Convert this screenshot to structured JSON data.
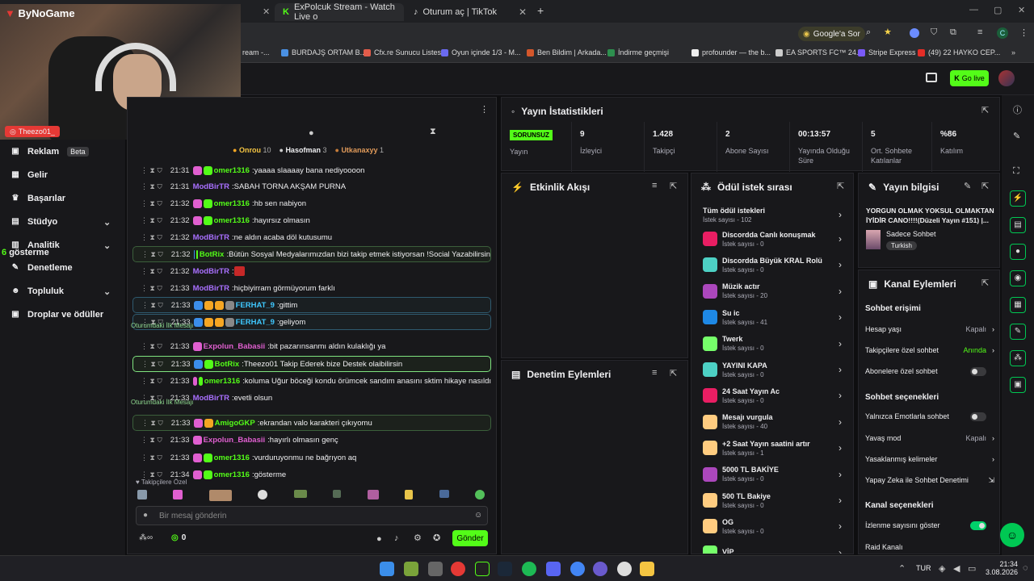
{
  "browser": {
    "tabs": [
      {
        "label": "ExPolcuk Stream - Watch Live o",
        "close": "✕"
      },
      {
        "label": "Oturum aç | TikTok",
        "close": "✕"
      }
    ],
    "add_tab": "+",
    "google_btn": "Google'a Sor",
    "bookmarks": [
      "ream -...",
      "BURDAJŞ ORTAM B...",
      "Cfx.re Sunucu Listesi",
      "Oyun içinde 1/3 - M...",
      "Ben Bildim | Arkada...",
      "İndirme geçmişi",
      "profounder — the b...",
      "EA SPORTS FC™ 24...",
      "Stripe Express",
      "(49) 22 HAYKO CEP..."
    ]
  },
  "webcam": {
    "logo": "ByNoGame",
    "username": "Theezo01_"
  },
  "topbar": {
    "go_live": "Go live"
  },
  "sidebar": {
    "items": [
      {
        "label": "Reklam",
        "badge": "Beta"
      },
      {
        "label": "Gelir"
      },
      {
        "label": "Başarılar"
      },
      {
        "label": "Stüdyo"
      },
      {
        "label": "Analitik"
      },
      {
        "label": "Denetleme"
      },
      {
        "label": "Topluluk"
      },
      {
        "label": "Droplar ve ödüller"
      }
    ],
    "overlay_num": "6",
    "overlay_text": "gösterme"
  },
  "chat": {
    "leaders": [
      {
        "name": "Onrou",
        "count": "10"
      },
      {
        "name": "Hasofman",
        "count": "3"
      },
      {
        "name": "Utkanaxyy",
        "count": "1"
      }
    ],
    "messages": [
      {
        "time": "21:31",
        "user": "omer1316",
        "text": "yaaaa slaaaay bana nediyoooon"
      },
      {
        "time": "21:31",
        "user": "ModBirTR",
        "text": "SABAH TORNA AKŞAM PURNA"
      },
      {
        "time": "21:32",
        "user": "omer1316",
        "text": "hb sen nabiyon"
      },
      {
        "time": "21:32",
        "user": "omer1316",
        "text": "hayırsız olmasın"
      },
      {
        "time": "21:32",
        "user": "ModBirTR",
        "text": "ne aldın acaba döl kutusumu"
      },
      {
        "time": "21:32",
        "user": "BotRix",
        "text": "Bütün Sosyal Medyalarımızdan bizi takip etmek istiyorsan !Social Yazabilirsin"
      },
      {
        "time": "21:32",
        "user": "ModBirTR",
        "text": ""
      },
      {
        "time": "21:33",
        "user": "ModBirTR",
        "text": "hiçbiyirram görmüyorum farklı"
      },
      {
        "time": "21:33",
        "user": "FERHAT_9",
        "text": "gittim"
      },
      {
        "time": "21:33",
        "user": "FERHAT_9",
        "text": "geliyom"
      },
      {
        "time": "21:33",
        "user": "Expolun_Babasii",
        "text": "bit pazarınsanmı aldın kulaklığı ya"
      },
      {
        "time": "21:33",
        "user": "BotRix",
        "text": "Theezo01 Takip Ederek bize Destek olaibilirsin"
      },
      {
        "time": "21:33",
        "user": "omer1316",
        "text": "koluma Uğur böceği kondu örümcek sandım anasını sktim hikaye nasıldı"
      },
      {
        "time": "21:33",
        "user": "ModBirTR",
        "text": "evetli olsun"
      },
      {
        "time": "21:33",
        "user": "AmigoGKP",
        "text": "ekrandan valo karakteri çıkıyomu"
      },
      {
        "time": "21:33",
        "user": "Expolun_Babasii",
        "text": "hayırlı olmasın genç"
      },
      {
        "time": "21:33",
        "user": "omer1316",
        "text": "vurduruyonmu ne bağrıyon aq"
      },
      {
        "time": "21:34",
        "user": "omer1316",
        "text": "gösterme"
      }
    ],
    "first_msg_label": "Oturumdaki İlk Mesajı",
    "followers_label": "Takipçilere Özel",
    "input_placeholder": "Bir mesaj gönderin",
    "points": "0",
    "send": "Gönder"
  },
  "stats": {
    "title": "Yayın İstatistikleri",
    "status": "SORUNSUZ",
    "status_label": "Yayın",
    "items": [
      {
        "value": "9",
        "label": "İzleyici"
      },
      {
        "value": "1.428",
        "label": "Takipçi"
      },
      {
        "value": "2",
        "label": "Abone Sayısı"
      },
      {
        "value": "00:13:57",
        "label": "Yayında Olduğu Süre"
      },
      {
        "value": "5",
        "label": "Ort. Sohbete Katılanlar"
      },
      {
        "value": "%86",
        "label": "Katılım"
      }
    ]
  },
  "activity": {
    "title": "Etkinlik Akışı"
  },
  "moderation": {
    "title": "Denetim Eylemleri"
  },
  "rewards": {
    "title": "Ödül istek sırası",
    "all_title": "Tüm ödül istekleri",
    "all_sub": "İstek sayısı - 102",
    "items": [
      {
        "name": "Discordda Canlı konuşmak",
        "sub": "İstek sayısı - 0",
        "color": "#e91e63"
      },
      {
        "name": "Discordda Büyük KRAL Rolü",
        "sub": "İstek sayısı - 0",
        "color": "#4dd0c4"
      },
      {
        "name": "Müzik actır",
        "sub": "İstek sayısı - 20",
        "color": "#ab47bc"
      },
      {
        "name": "Su ic",
        "sub": "İstek sayısı - 41",
        "color": "#1e88e5"
      },
      {
        "name": "Twerk",
        "sub": "İstek sayısı - 0",
        "color": "#76ff6a"
      },
      {
        "name": "YAYINI KAPA",
        "sub": "İstek sayısı - 0",
        "color": "#4dd0c4"
      },
      {
        "name": "24 Saat Yayın Ac",
        "sub": "İstek sayısı - 0",
        "color": "#e91e63"
      },
      {
        "name": "Mesajı vurgula",
        "sub": "İstek sayısı - 40",
        "color": "#ffcc80"
      },
      {
        "name": "+2 Saat Yayın saatini artır",
        "sub": "İstek sayısı - 1",
        "color": "#ffcc80"
      },
      {
        "name": "5000 TL BAKİYE",
        "sub": "İstek sayısı - 0",
        "color": "#ab47bc"
      },
      {
        "name": "500 TL Bakiye",
        "sub": "İstek sayısı - 0",
        "color": "#ffcc80"
      },
      {
        "name": "OG",
        "sub": "İstek sayısı - 0",
        "color": "#ffcc80"
      },
      {
        "name": "VİP",
        "sub": "",
        "color": "#76ff6a"
      }
    ]
  },
  "info": {
    "title": "Yayın bilgisi",
    "stream_title": "YORGUN OLMAK YOKSUL OLMAKTAN İYİDİR CANO!!!!(Düzeli Yayın #151) |...",
    "category": "Sadece Sohbet",
    "tag": "Turkish"
  },
  "channel": {
    "title": "Kanal Eylemleri",
    "chat_access": "Sohbet erişimi",
    "account_age": "Hesap yaşı",
    "account_age_val": "Kapalı",
    "followers_only": "Takipçilere özel sohbet",
    "followers_only_val": "Anında",
    "subs_only": "Abonelere özel sohbet",
    "chat_options": "Sohbet seçenekleri",
    "emotes_only": "Yalnızca Emotlarla sohbet",
    "slow_mode": "Yavaş mod",
    "slow_mode_val": "Kapalı",
    "banned_words": "Yasaklanmış kelimeler",
    "ai_mod": "Yapay Zeka ile Sohbet Denetimi",
    "channel_options": "Kanal seçenekleri",
    "show_viewers": "İzlenme sayısını göster",
    "raid": "Raid Kanalı"
  },
  "taskbar": {
    "lang": "TUR",
    "time": "21:34",
    "date": "3.08.2026"
  },
  "colors": {
    "green": "#53fc18",
    "purple": "#9147ff"
  }
}
